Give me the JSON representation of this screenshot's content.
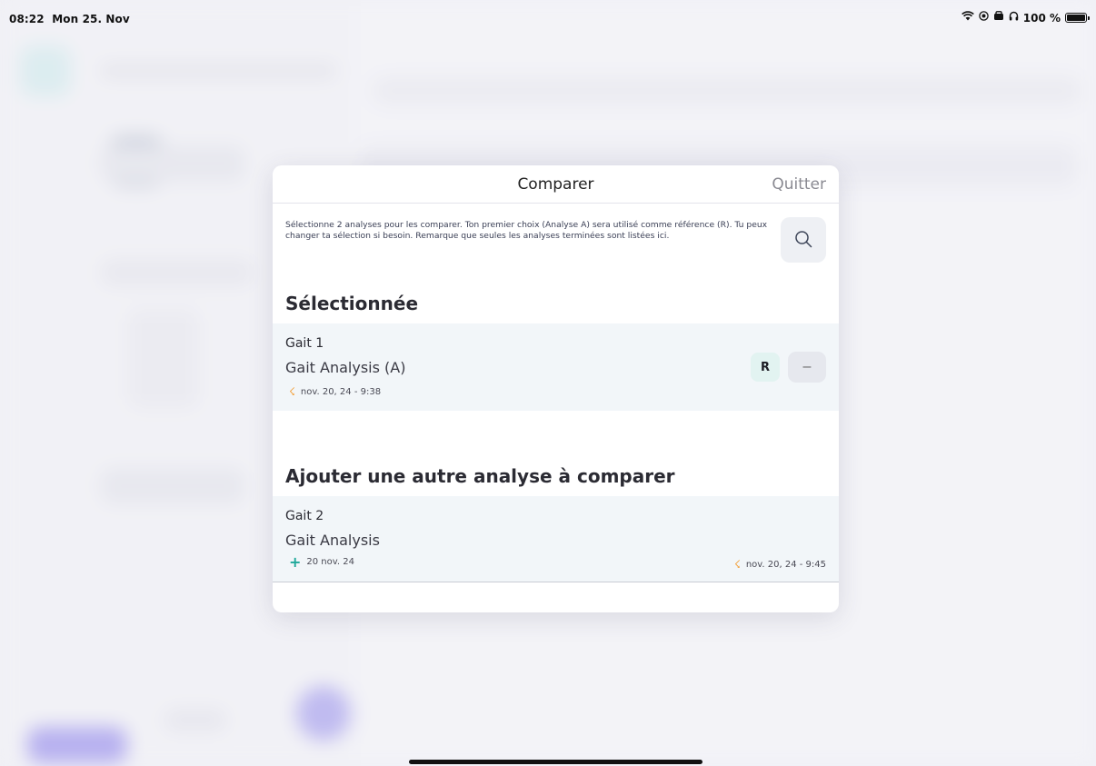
{
  "status_bar": {
    "time": "08:22",
    "date": "Mon 25. Nov",
    "battery_percent": "100 %"
  },
  "modal": {
    "title": "Comparer",
    "quit_label": "Quitter",
    "intro": "Sélectionne 2 analyses pour les comparer. Ton premier choix (Analyse A) sera utilisé comme référence (R). Tu peux changer ta sélection si besoin. Remarque que seules les analyses terminées sont listées ici.",
    "search_icon": "search-icon",
    "selected_section": {
      "title": "Sélectionnée",
      "item": {
        "name": "Gait 1",
        "type": "Gait Analysis (A)",
        "timestamp": "nov. 20, 24 - 9:38",
        "reference_badge": "R",
        "remove_label": "–"
      }
    },
    "add_section": {
      "title": "Ajouter une autre analyse à comparer",
      "item": {
        "name": "Gait 2",
        "type": "Gait Analysis",
        "created": "20 nov. 24",
        "timestamp": "nov. 20, 24 - 9:45"
      }
    }
  },
  "colors": {
    "accent_teal": "#1ea89a",
    "bolt_orange": "#f39a2c",
    "row_background": "#f2f6f9"
  }
}
